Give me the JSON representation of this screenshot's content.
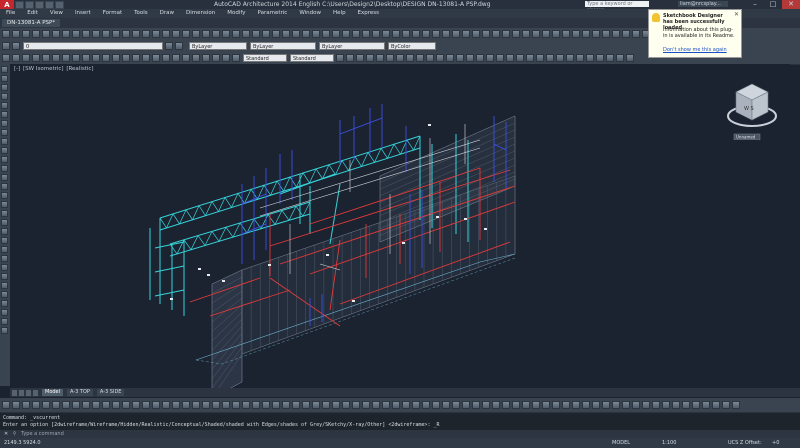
{
  "titlebar": {
    "title": "AutoCAD Architecture 2014    English    C:\\Users\\Design2\\Desktop\\DESIGN DN-13081-A PSP.dwg",
    "search_placeholder": "Type a keyword or phrase",
    "signin": "liam@nrcsplay..."
  },
  "menu": [
    "File",
    "Edit",
    "View",
    "Insert",
    "Format",
    "Tools",
    "Draw",
    "Dimension",
    "Modify",
    "Parametric",
    "Window",
    "Help",
    "Express"
  ],
  "file_tab": "DN-13081-A PSP*",
  "toolbar2": {
    "layer_value": "0",
    "color_value": "ByLayer",
    "linetype_value": "ByLayer",
    "lineweight_value": "ByLayer",
    "plotstyle_value": "ByColor"
  },
  "toolbar3": {
    "textstyle_value": "Standard",
    "dimstyle_value": "Standard"
  },
  "viewport": {
    "label_parts": [
      "[-]",
      "[SW Isometric]",
      "[Realistic]"
    ]
  },
  "viewcube": {
    "face_label": "W S",
    "ucs_label": "Unnamed"
  },
  "balloon": {
    "title": "Sketchbook Designer has been successfully loaded.",
    "body": "Information about this plug-in is available in its Readme.",
    "link": "Don't show me this again"
  },
  "layout_tabs": [
    {
      "label": "Model",
      "active": true
    },
    {
      "label": "A-3 TOP",
      "active": false
    },
    {
      "label": "A-3 SIDE",
      "active": false
    }
  ],
  "command": {
    "line1": "Command: _vscurrent",
    "line2": "Enter an option [2dwireframe/Wireframe/Hidden/Realistic/Conceptual/Shaded/shaded with Edges/shades of Grey/SKetchy/X-ray/Other] <2dwireframe>: _R",
    "prompt": "Type a command"
  },
  "status": {
    "coords": "2149.3   5924.0",
    "model": "MODEL",
    "scale": "1:100",
    "ucs": "UCS Z Offset:",
    "offset": "+0"
  },
  "colors": {
    "background": "#1b2331",
    "frame_cyan": "#35d3d8",
    "frame_red": "#e23a3a",
    "frame_blue": "#3d4fe6",
    "frame_white": "#d8dde4"
  }
}
